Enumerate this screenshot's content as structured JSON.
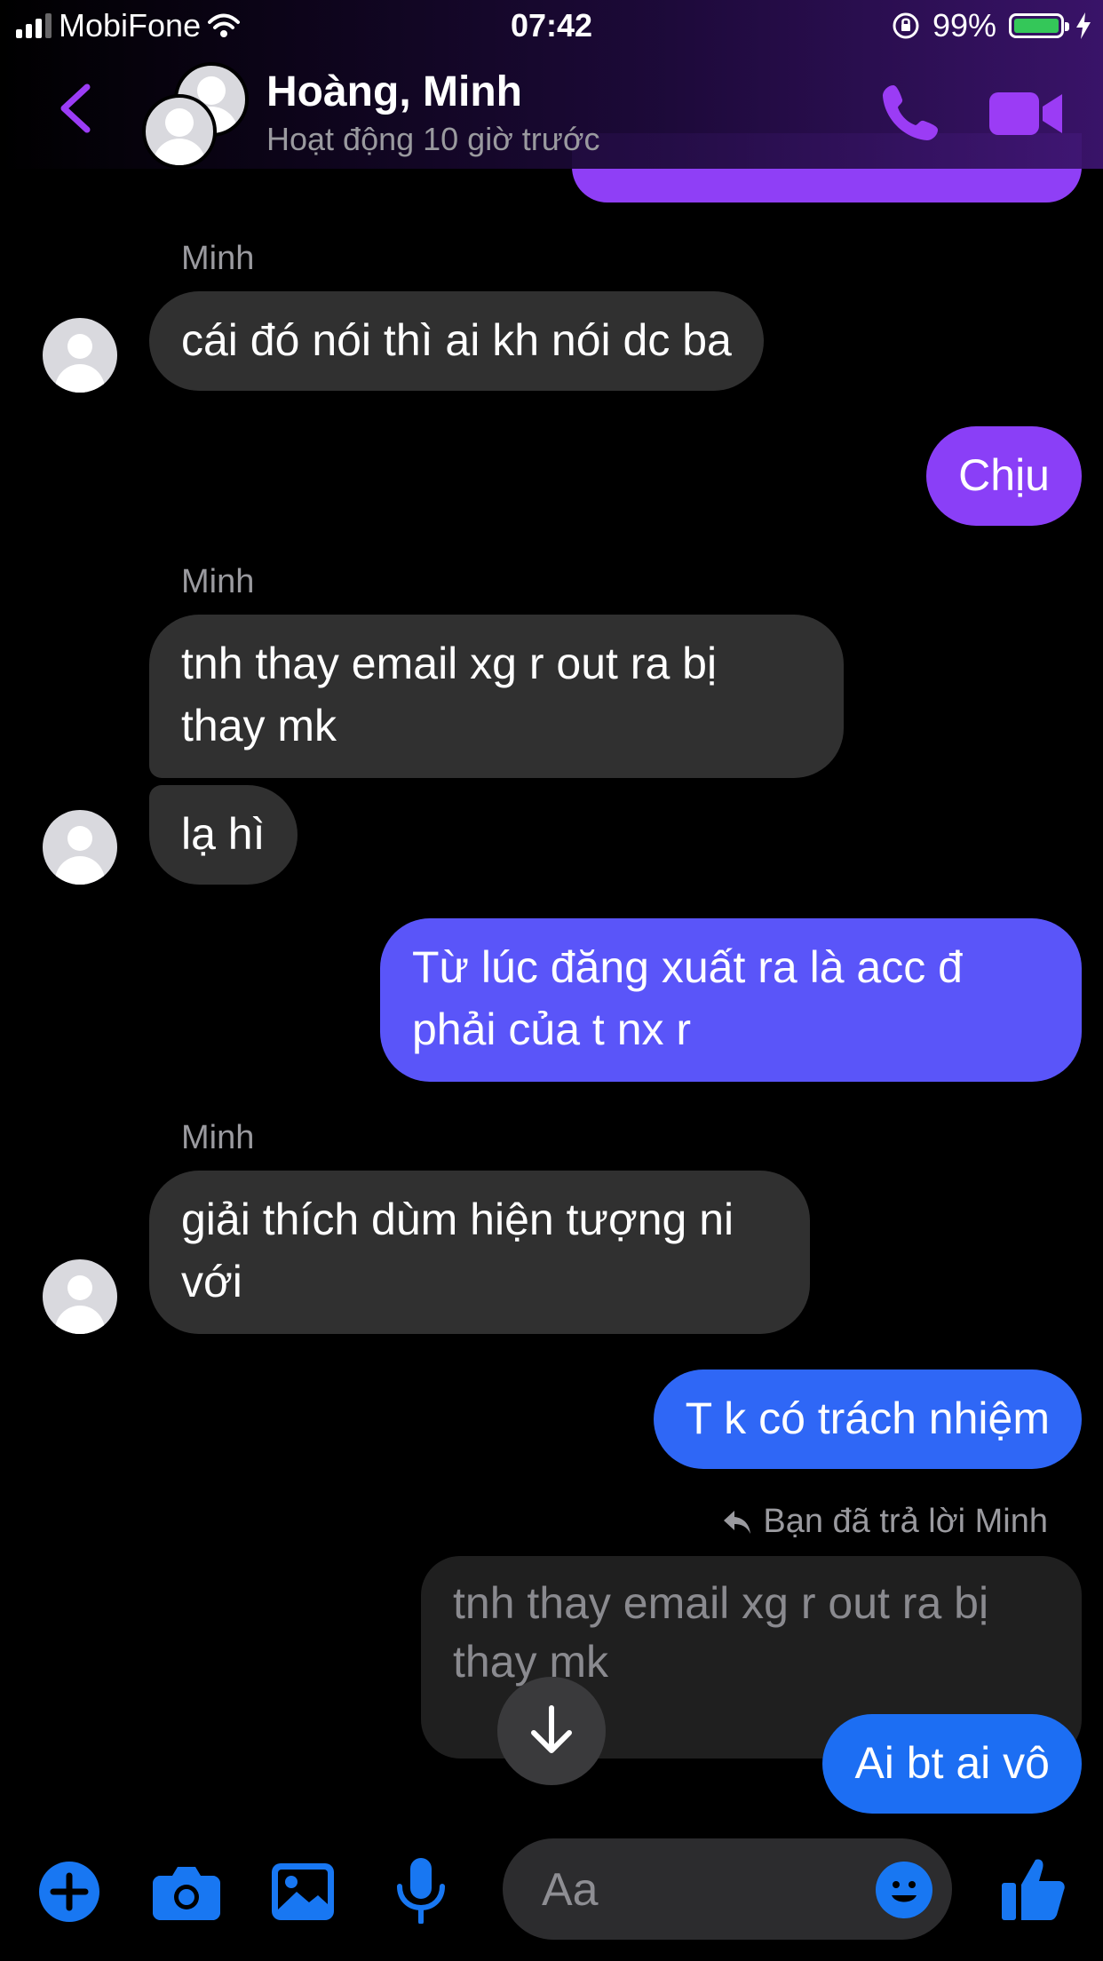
{
  "status_bar": {
    "carrier": "MobiFone",
    "time": "07:42",
    "battery": "99%"
  },
  "header": {
    "name": "Hoàng, Minh",
    "status": "Hoạt động 10 giờ trước"
  },
  "messages": [
    {
      "sender": "Minh",
      "text": "cái đó nói thì ai kh nói dc ba"
    },
    {
      "text": "Chịu"
    },
    {
      "sender": "Minh",
      "text": "tnh thay email xg r out ra bị thay mk"
    },
    {
      "text": "lạ hì"
    },
    {
      "text": "Từ lúc đăng xuất ra là acc đ phải của t nx r"
    },
    {
      "sender": "Minh",
      "text": "giải thích dùm hiện tượng ni với"
    },
    {
      "text": "T k có trách nhiệm"
    },
    {
      "reply_label": "Bạn đã trả lời Minh",
      "quoted": "tnh thay email xg r out ra bị thay mk",
      "text": "Ai bt ai vô"
    }
  ],
  "composer": {
    "placeholder": "Aa"
  },
  "colors": {
    "accent": "#9b3cf5",
    "blue": "#1877f2",
    "incoming": "#303030"
  },
  "icons": [
    "back-chevron-icon",
    "phone-icon",
    "video-camera-icon",
    "arrow-down-icon",
    "plus-icon",
    "camera-icon",
    "image-icon",
    "microphone-icon",
    "emoji-icon",
    "thumbs-up-icon",
    "reply-arrow-icon"
  ]
}
